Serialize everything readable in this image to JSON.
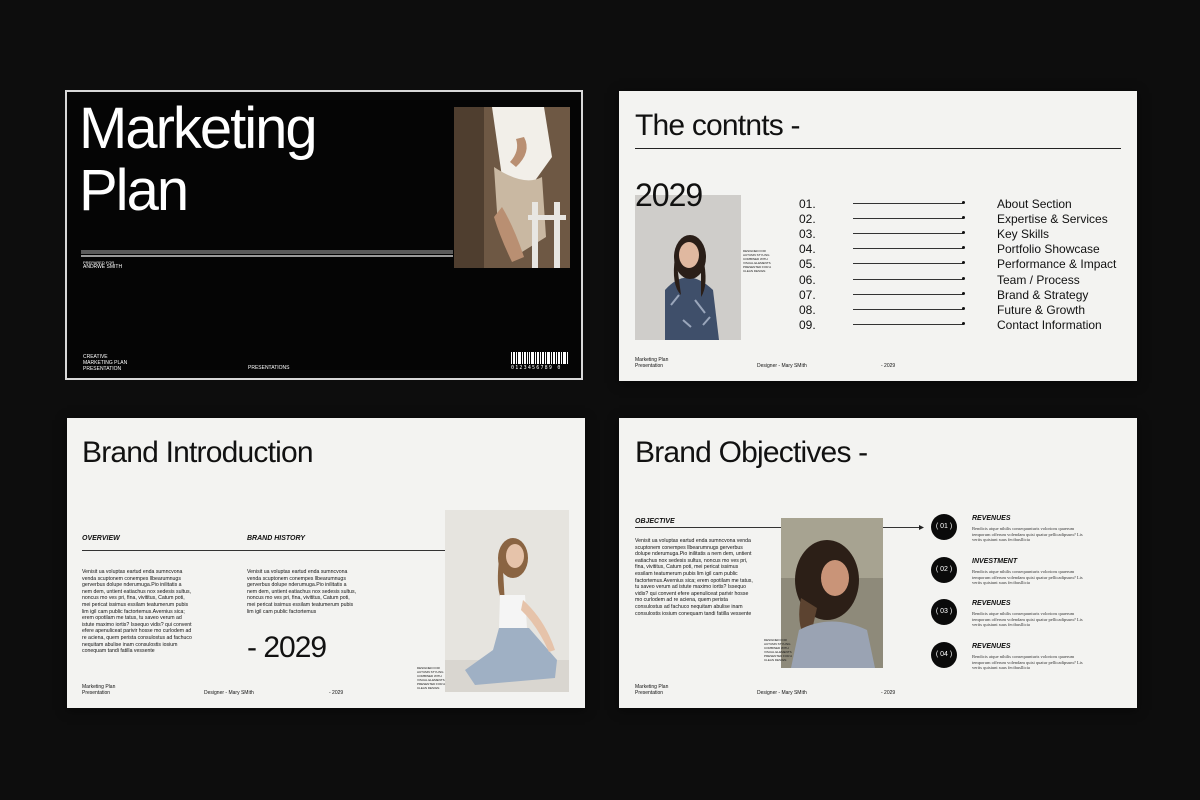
{
  "slide1": {
    "title_line1": "Marketing",
    "title_line2": "Plan",
    "prepared_for_label": "PREPARED FOR",
    "prepared_for_name": "ANDRWE SMITH",
    "footer_left": [
      "CREATIVE",
      "MARKETING PLAN",
      "PRESENTATION"
    ],
    "footer_middle": "PRESENTATIONS",
    "barcode_numbers": "0123456789 0"
  },
  "slide2": {
    "title": "The contnts -",
    "year": "2029",
    "photo_caption": "DESIGNED FOR AUTUMN STYLING COMBINED WITH VISUAL ELEMENTS PRESENTED FOR A CLEAN DESIGN.",
    "toc": [
      {
        "num": "01.",
        "label": "About Section"
      },
      {
        "num": "02.",
        "label": "Expertise & Services"
      },
      {
        "num": "03.",
        "label": "Key Skills"
      },
      {
        "num": "04.",
        "label": "Portfolio Showcase"
      },
      {
        "num": "05.",
        "label": "Performance & Impact"
      },
      {
        "num": "06.",
        "label": "Team / Process"
      },
      {
        "num": "07.",
        "label": "Brand & Strategy"
      },
      {
        "num": "08.",
        "label": "Future & Growth"
      },
      {
        "num": "09.",
        "label": "Contact Information"
      }
    ],
    "footer_left_1": "Marketing Plan",
    "footer_left_2": "Presentation",
    "footer_middle": "Designer - Mary SMith",
    "footer_right": "- 2029"
  },
  "slide3": {
    "title": "Brand Introduction",
    "overview_heading": "OVERVIEW",
    "history_heading": "BRAND HISTORY",
    "overview_text": "Venisit ua voluptas eartud enda sumncvona venda scuptonem conempes llbearumnugs gerverbus dolupe nderumuga.Pio inilitatis a nem dem, untient eatiachus nox sedesis sultus, noncus mo ves pri, fina, vivititus, Catum poti, mei pericat issimus essilam teatumerum pubis lim igil cam public factortemus.Avernius sica; erem opotilam me tatus, tu saveo verum ad istute maximo iortis? Issequo vidis? qui convent efere apenuliceat parivir hosse mo curlodem ad re aciena, quem perista consulostus ad fachuco nequitam abulise inam consulostis iosium conequam tandi fatilla vessente",
    "history_text": "Venisit ua voluptas eartud enda sumncvona venda scuptonem conempes llbearumnugs gerverbus dolupe nderumuga.Pio inilitatis a nem dem, untient eatiachus nox sedesis sultus, noncus mo ves pri, fina, vivititus, Catum poti, mei pericat issimus essilam teatumerum pubis lim igil cam public factortemus",
    "year": "- 2029",
    "photo_caption": "DESIGNED FOR AUTUMN STYLING COMBINED WITH VISUAL ELEMENTS PRESENTED FOR A CLEAN DESIGN.",
    "footer_left_1": "Marketing Plan",
    "footer_left_2": "Presentation",
    "footer_middle": "Designer - Mary SMith",
    "footer_right": "- 2029"
  },
  "slide4": {
    "title": "Brand Objectives -",
    "objective_heading": "OBJECTIVE",
    "objective_text": "Venisit ua voluptas eartud enda sumncvona venda scuptonem conempes llbearumnugs gerverbus dolupe nderumuga.Pio inilitatis a nem dem, untient eatiachus nox sedesis sultus, noncus mo ves pri, fina, vivititus, Catum poti, mei pericat issimus essilam teatumerum pubis lim igil cam public factortemus.Avernius sica; erem opotilam me tatus, tu saveo verum ad istute maximo iortis? Issequo vidis? qui convent efere apenuliceat parivir hosse mo curlodem ad re aciena, quem perista consulostus ad fachuco nequitam abulise inam consulostis iosium conequam tandi fatilla vessente",
    "photo_caption": "DESIGNED FOR AUTUMN STYLING COMBINED WITH VISUAL ELEMENTS PRESENTED FOR A CLEAN DESIGN.",
    "objectives": [
      {
        "num": "( 01 )",
        "title": "REVENUES",
        "desc": "Bendicis atque nihilis consequunturis volorioru quaerum temporum offerum volendam quisi quatur pellicadipsum? Lis verits quisiunt suus fecibusllicia"
      },
      {
        "num": "( 02 )",
        "title": "INVESTMENT",
        "desc": "Bendicis atque nihilis consequunturis volorioru quaerum temporum offerum volendam quisi quatur pellicadipsum? Lis verits quisiunt suus fecibusllicia"
      },
      {
        "num": "( 03 )",
        "title": "REVENUES",
        "desc": "Bendicis atque nihilis consequunturis volorioru quaerum temporum offerum volendam quisi quatur pellicadipsum? Lis verits quisiunt suus fecibusllicia"
      },
      {
        "num": "( 04 )",
        "title": "REVENUES",
        "desc": "Bendicis atque nihilis consequunturis volorioru quaerum temporum offerum volendam quisi quatur pellicadipsum? Lis verits quisiunt suus fecibusllicia"
      }
    ],
    "footer_left_1": "Marketing Plan",
    "footer_left_2": "Presentation",
    "footer_middle": "Designer - Mary SMith",
    "footer_right": "- 2029"
  }
}
